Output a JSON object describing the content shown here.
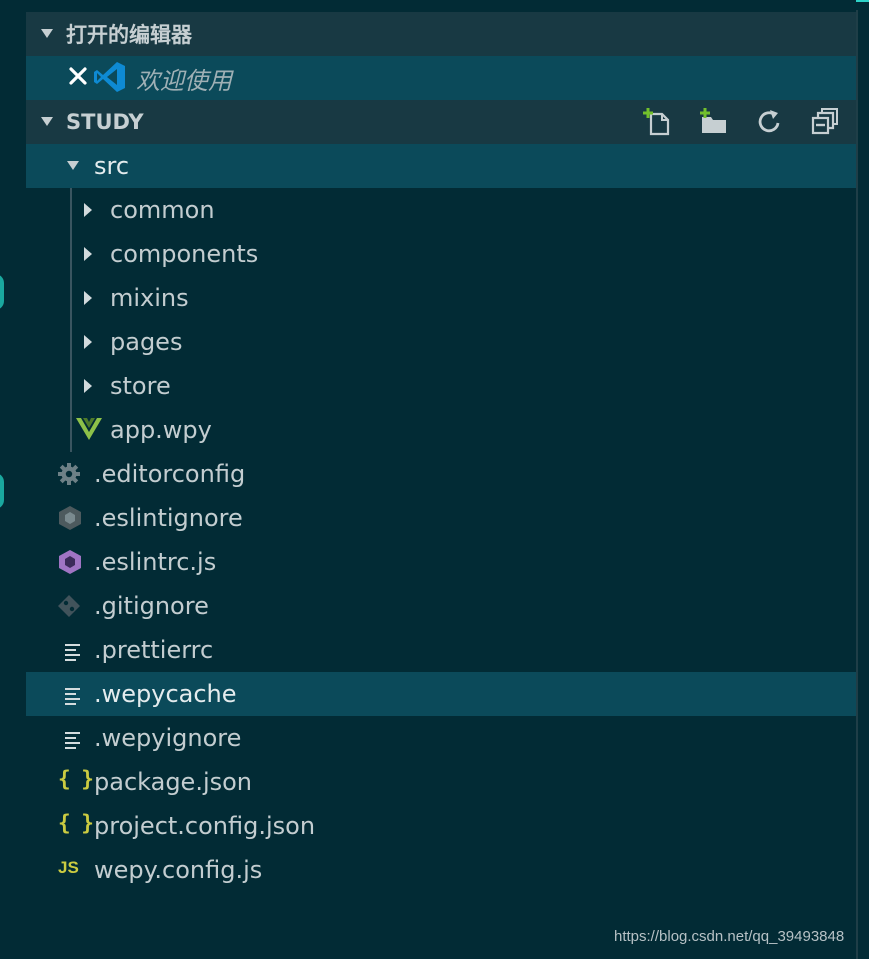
{
  "open_editors": {
    "header": "打开的编辑器",
    "items": [
      {
        "label": "欢迎使用",
        "icon": "vscode-logo-icon",
        "close_icon": "close-icon"
      }
    ]
  },
  "explorer": {
    "folder_name": "STUDY",
    "actions": [
      {
        "name": "new-file-button",
        "icon": "new-file-icon"
      },
      {
        "name": "new-folder-button",
        "icon": "new-folder-icon"
      },
      {
        "name": "refresh-button",
        "icon": "refresh-icon"
      },
      {
        "name": "collapse-all-button",
        "icon": "collapse-all-icon"
      }
    ],
    "src": {
      "label": "src"
    },
    "src_children": [
      {
        "label": "common",
        "type": "folder"
      },
      {
        "label": "components",
        "type": "folder"
      },
      {
        "label": "mixins",
        "type": "folder"
      },
      {
        "label": "pages",
        "type": "folder"
      },
      {
        "label": "store",
        "type": "folder"
      },
      {
        "label": "app.wpy",
        "type": "file",
        "icon": "vue-icon"
      }
    ],
    "root_files": [
      {
        "label": ".editorconfig",
        "icon": "gear-icon"
      },
      {
        "label": ".eslintignore",
        "icon": "eslint-gray-icon"
      },
      {
        "label": ".eslintrc.js",
        "icon": "eslint-icon"
      },
      {
        "label": ".gitignore",
        "icon": "git-icon"
      },
      {
        "label": ".prettierrc",
        "icon": "text-lines-icon"
      },
      {
        "label": ".wepycache",
        "icon": "text-lines-icon"
      },
      {
        "label": ".wepyignore",
        "icon": "text-lines-icon"
      },
      {
        "label": "package.json",
        "icon": "json-braces-icon"
      },
      {
        "label": "project.config.json",
        "icon": "json-braces-icon"
      },
      {
        "label": "wepy.config.js",
        "icon": "javascript-icon"
      }
    ],
    "selected": ".wepycache"
  },
  "json_icon_text": "{ }",
  "js_icon_text": "JS",
  "watermark": "https://blog.csdn.net/qq_39493848",
  "colors": {
    "background": "#022b35",
    "header": "#183943",
    "selection": "#0b4a5a",
    "vue": "#8dc149",
    "json": "#cbcb41",
    "eslint": "#a074c4",
    "vscode": "#0e8ad3"
  }
}
